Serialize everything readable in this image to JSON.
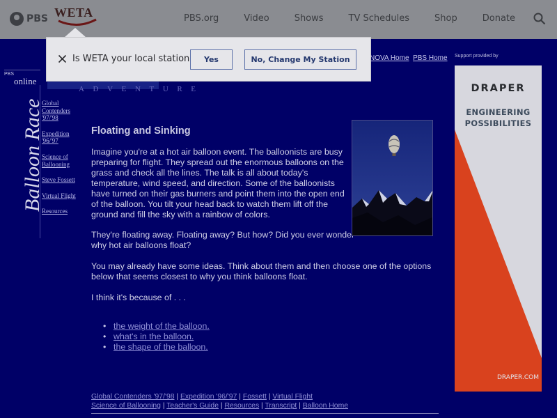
{
  "topnav": {
    "pbs_label": "PBS",
    "station_logo": "WETA",
    "links": [
      "PBS.org",
      "Video",
      "Shows",
      "TV Schedules",
      "Shop",
      "Donate"
    ],
    "search_icon": "search-icon"
  },
  "popup": {
    "question": "Is WETA your local station?",
    "yes_label": "Yes",
    "change_label": "No, Change My Station",
    "close_icon": "close-icon"
  },
  "header": {
    "pbs_online_small": "PBS",
    "pbs_online_word": "online",
    "adventure": "ADVENTURE",
    "nova_home": "NOVA Home",
    "pbs_home": "PBS Home"
  },
  "sidebar": {
    "title": "Balloon Race",
    "items": [
      {
        "label": "Global Contenders '97/'98"
      },
      {
        "label": "Expedition '96/'97"
      },
      {
        "label": "Science of Ballooning"
      },
      {
        "label": "Steve Fossett"
      },
      {
        "label": "Virtual Flight"
      },
      {
        "label": "Resources"
      }
    ]
  },
  "content": {
    "title": "Floating and Sinking",
    "p1": "Imagine you're at a hot air balloon event. The balloonists are busy preparing for flight. They spread out the enormous balloons on the grass and check all the lines. The talk is all about today's temperature, wind speed, and direction. Some of the balloonists have turned on their gas burners and point them into the open end of the balloon. You tilt your head back to watch them lift off the ground and fill the sky with a rainbow of colors.",
    "p2": "They're floating away. Floating away? But how? Did you ever wonder why hot air balloons float?",
    "p3": "You may already have some ideas. Think about them and then choose one of the options below that seems closest to why you think balloons float.",
    "p4": "I think it's because of . . .",
    "choices": [
      {
        "label": "the weight of the balloon."
      },
      {
        "label": "what's in the balloon."
      },
      {
        "label": "the shape of the balloon."
      }
    ]
  },
  "footer": {
    "row1": [
      "Global Contenders '97/'98",
      "Expedition '96/'97",
      "Fossett",
      "Virtual Flight"
    ],
    "row2": [
      "Science of Ballooning",
      "Teacher's Guide",
      "Resources",
      "Transcript",
      "Balloon Home"
    ],
    "separator": "|"
  },
  "ad": {
    "label": "Support provided by",
    "brand": "DRAPER",
    "tagline_1": "ENGINEERING",
    "tagline_2": "POSSIBILITIES",
    "url": "DRAPER.COM",
    "colors": {
      "accent": "#d9421e",
      "background": "#d7d7de"
    }
  },
  "colors": {
    "page_bg": "#00006b",
    "topnav_bg": "#8a8c91",
    "link": "#8f8fd6"
  }
}
